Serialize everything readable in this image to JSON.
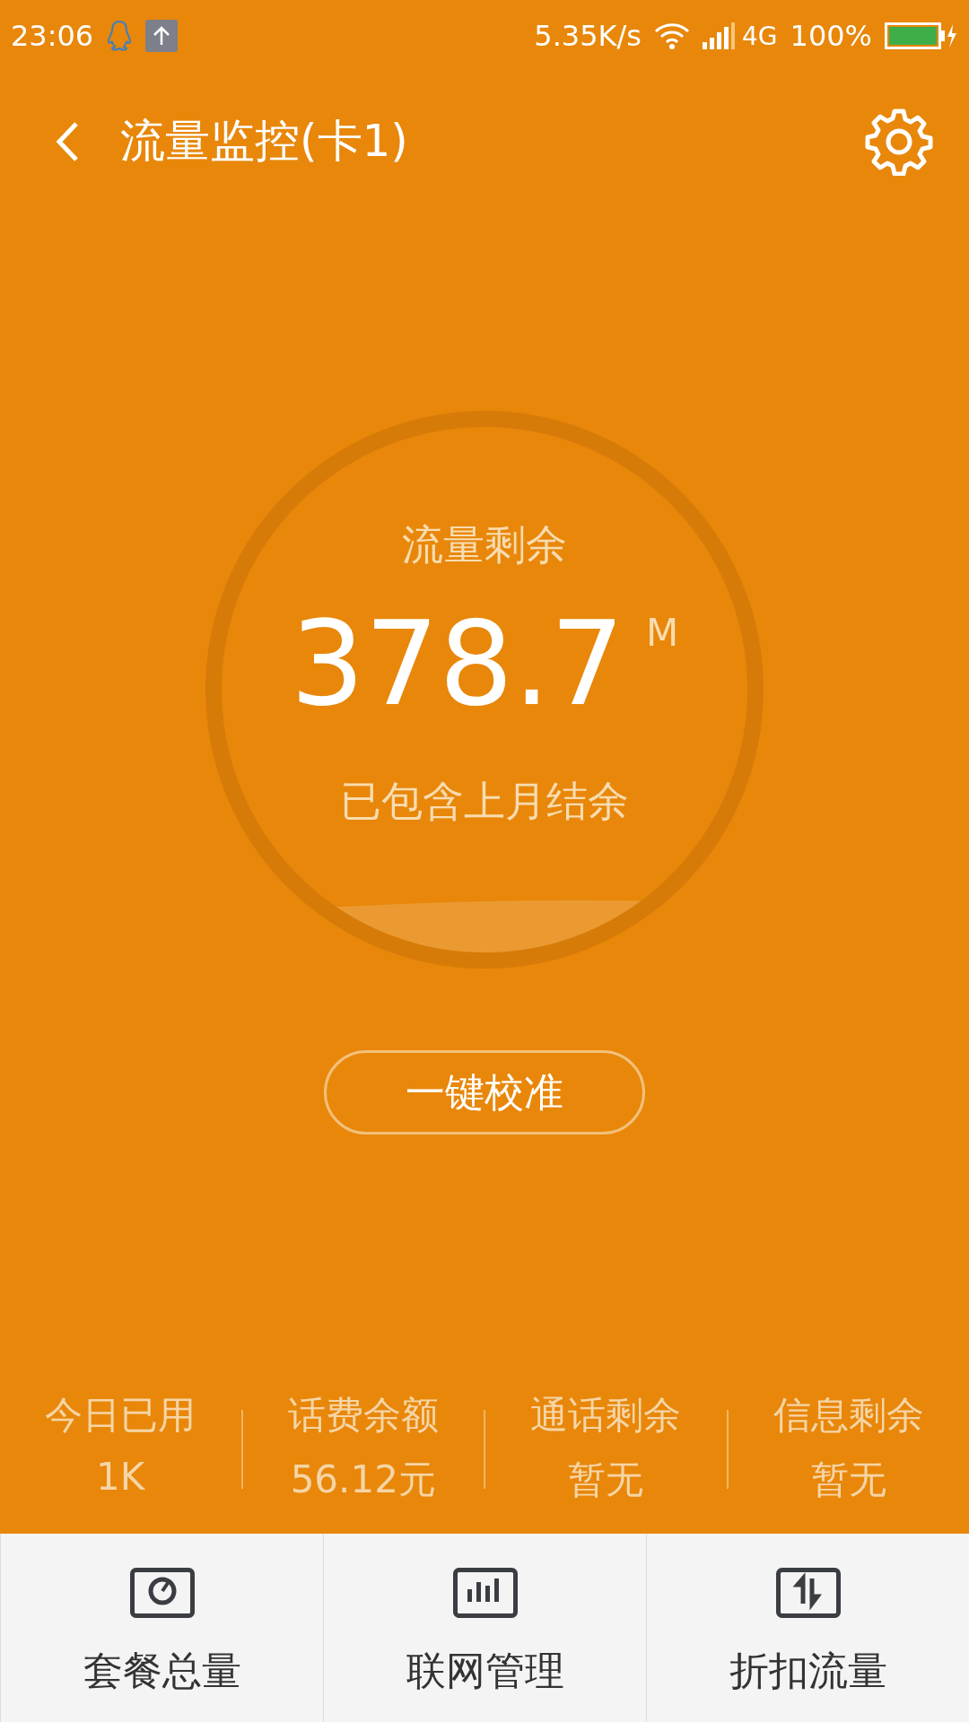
{
  "status_bar": {
    "time": "23:06",
    "speed": "5.35K/s",
    "network": "4G",
    "battery": "100%"
  },
  "header": {
    "title": "流量监控(卡1)"
  },
  "gauge": {
    "label": "流量剩余",
    "value": "378.7",
    "unit": "M",
    "note": "已包含上月结余"
  },
  "calibrate_button": "一键校准",
  "stats": [
    {
      "label": "今日已用",
      "value": "1K"
    },
    {
      "label": "话费余额",
      "value": "56.12元"
    },
    {
      "label": "通话剩余",
      "value": "暂无"
    },
    {
      "label": "信息剩余",
      "value": "暂无"
    }
  ],
  "bottom_nav": [
    {
      "kind": "gauge",
      "label": "套餐总量"
    },
    {
      "kind": "bars",
      "label": "联网管理"
    },
    {
      "kind": "swap",
      "label": "折扣流量"
    }
  ]
}
